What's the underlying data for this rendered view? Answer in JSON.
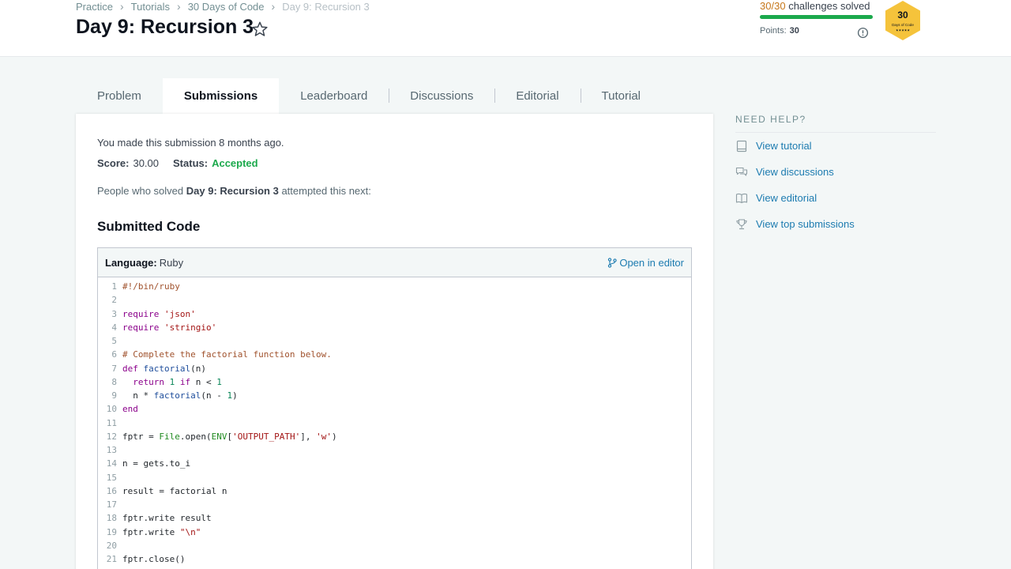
{
  "breadcrumb": [
    "Practice",
    "Tutorials",
    "30 Days of Code",
    "Day 9: Recursion 3"
  ],
  "title": "Day 9: Recursion 3",
  "progress": {
    "solved": "30",
    "total": "30",
    "text": "challenges solved",
    "fraction": 1.0,
    "points_label": "Points:",
    "points": "30"
  },
  "badge": {
    "number": "30",
    "label": "Days of Code",
    "stars": "★★★★★"
  },
  "tabs": [
    "Problem",
    "Submissions",
    "Leaderboard",
    "Discussions",
    "Editorial",
    "Tutorial"
  ],
  "active_tab": "Submissions",
  "submission": {
    "made": "You made this submission 8 months ago.",
    "score_label": "Score:",
    "score": "30.00",
    "status_label": "Status:",
    "status": "Accepted",
    "attempted_prefix": "People who solved",
    "attempted_bold": "Day 9: Recursion 3",
    "attempted_suffix": "attempted this next:"
  },
  "code": {
    "section_title": "Submitted Code",
    "language_label": "Language:",
    "language": "Ruby",
    "open_editor": "Open in editor",
    "lines": [
      "#!/bin/ruby",
      "",
      "require 'json'",
      "require 'stringio'",
      "",
      "# Complete the factorial function below.",
      "def factorial(n)",
      "  return 1 if n < 1",
      "  n * factorial(n - 1)",
      "end",
      "",
      "fptr = File.open(ENV['OUTPUT_PATH'], 'w')",
      "",
      "n = gets.to_i",
      "",
      "result = factorial n",
      "",
      "fptr.write result",
      "fptr.write \"\\n\"",
      "",
      "fptr.close()"
    ]
  },
  "help": {
    "title": "NEED HELP?",
    "items": [
      {
        "label": "View tutorial",
        "icon": "book-icon"
      },
      {
        "label": "View discussions",
        "icon": "chat-icon"
      },
      {
        "label": "View editorial",
        "icon": "open-book-icon"
      },
      {
        "label": "View top submissions",
        "icon": "trophy-icon"
      }
    ]
  },
  "colors": {
    "accent_green": "#1ba94c",
    "link_blue": "#1c7bb0",
    "badge_gold": "#f5c33b"
  }
}
